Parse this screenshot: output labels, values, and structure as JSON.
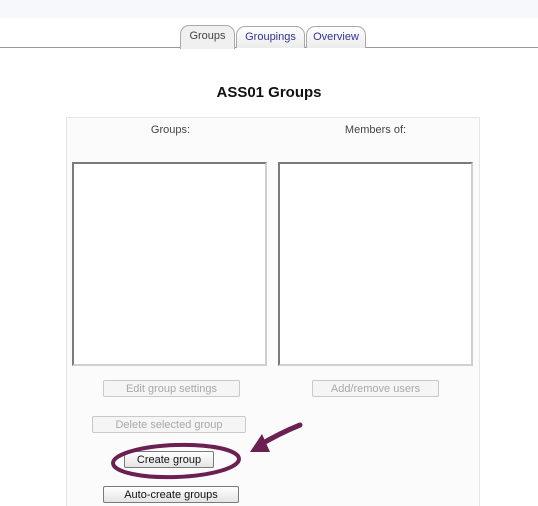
{
  "tabs": [
    {
      "label": "Groups",
      "active": true
    },
    {
      "label": "Groupings",
      "active": false
    },
    {
      "label": "Overview",
      "active": false
    }
  ],
  "page": {
    "title": "ASS01 Groups"
  },
  "columns": {
    "groups_label": "Groups:",
    "members_label": "Members of:"
  },
  "buttons": {
    "edit_group_settings": "Edit group settings",
    "add_remove_users": "Add/remove users",
    "delete_selected_group": "Delete selected group",
    "create_group": "Create group",
    "auto_create_groups": "Auto-create groups"
  },
  "annotation": {
    "color": "#6b1f52",
    "highlight_target": "create-group-button"
  }
}
